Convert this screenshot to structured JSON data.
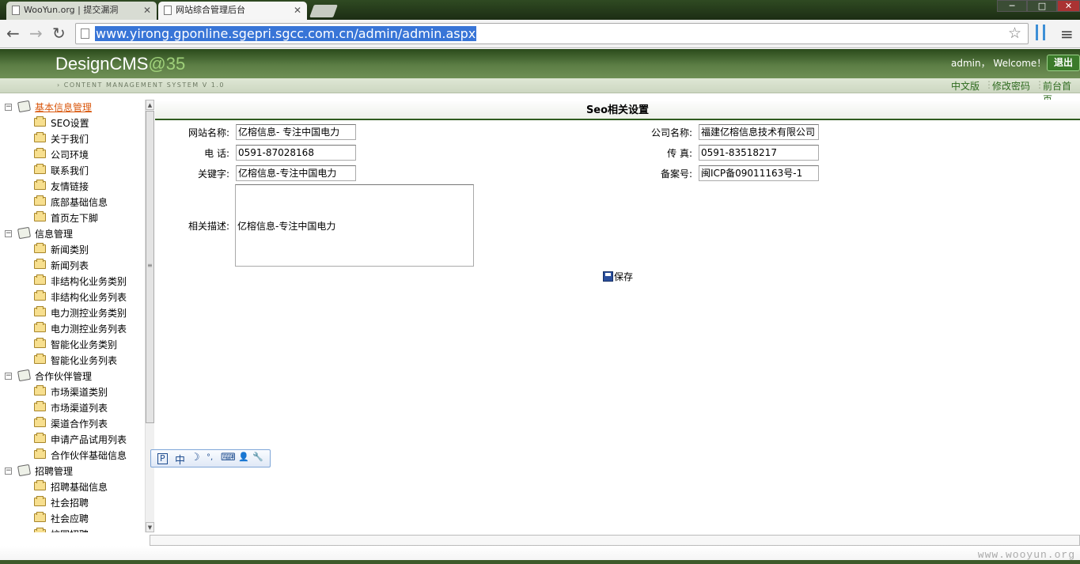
{
  "browser": {
    "tabs": [
      {
        "title": "WooYun.org | 提交漏洞"
      },
      {
        "title": "网站综合管理后台"
      }
    ],
    "url": "www.yirong.gponline.sgepri.sgcc.com.cn/admin/admin.aspx"
  },
  "header": {
    "logo_text": "DesignCMS",
    "logo_suffix": "@35",
    "tagline": "› CONTENT MANAGEMENT SYSTEM V 1.0",
    "welcome": "admin， Welcome！",
    "logout": "退出"
  },
  "quicklinks": [
    "中文版",
    "修改密码",
    "前台首页"
  ],
  "tree": [
    {
      "label": "基本信息管理",
      "items": [
        "SEO设置",
        "关于我们",
        "公司环境",
        "联系我们",
        "友情链接",
        "底部基础信息",
        "首页左下脚"
      ]
    },
    {
      "label": "信息管理",
      "items": [
        "新闻类别",
        "新闻列表",
        "非结构化业务类别",
        "非结构化业务列表",
        "电力测控业务类别",
        "电力测控业务列表",
        "智能化业务类别",
        "智能化业务列表"
      ]
    },
    {
      "label": "合作伙伴管理",
      "items": [
        "市场渠道类别",
        "市场渠道列表",
        "渠道合作列表",
        "申请产品试用列表",
        "合作伙伴基础信息"
      ]
    },
    {
      "label": "招聘管理",
      "items": [
        "招聘基础信息",
        "社会招聘",
        "社会应聘",
        "校园招聘"
      ]
    }
  ],
  "form": {
    "title": "Seo相关设置",
    "site_name": {
      "label": "网站名称:",
      "value": "亿榕信息- 专注中国电力"
    },
    "company_name": {
      "label": "公司名称:",
      "value": "福建亿榕信息技术有限公司"
    },
    "phone": {
      "label": "电 话:",
      "value": "0591-87028168"
    },
    "fax": {
      "label": "传 真:",
      "value": "0591-83518217"
    },
    "keywords": {
      "label": "关键字:",
      "value": "亿榕信息-专注中国电力"
    },
    "icp": {
      "label": "备案号:",
      "value": "闽ICP备09011163号-1"
    },
    "description": {
      "label": "相关描述:",
      "value": "亿榕信息-专注中国电力"
    },
    "save": "保存"
  },
  "ime": {
    "items": [
      "P",
      "中",
      "☽",
      "°,",
      "⌨",
      "👤",
      "🔧"
    ]
  },
  "watermark": "www.wooyun.org"
}
